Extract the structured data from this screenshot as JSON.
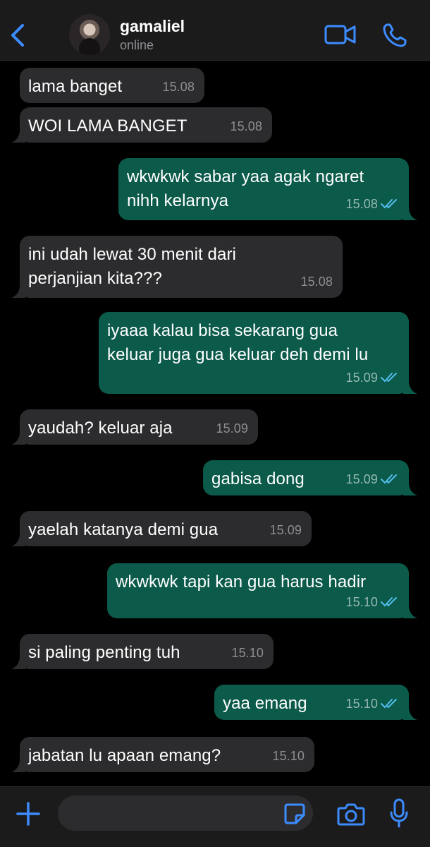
{
  "header": {
    "back_icon": "chevron-left-icon",
    "contact_name": "gamaliel",
    "contact_status": "online",
    "video_icon": "video-call-icon",
    "call_icon": "phone-icon",
    "accent_color": "#3d8cff"
  },
  "messages": [
    {
      "direction": "in",
      "text": [
        "lama banget"
      ],
      "time": "15.08"
    },
    {
      "direction": "in",
      "text": [
        "WOI LAMA BANGET"
      ],
      "time": "15.08"
    },
    {
      "direction": "out",
      "text": [
        "wkwkwk sabar yaa agak ngaret",
        "nihh kelarnya"
      ],
      "time": "15.08",
      "read": true
    },
    {
      "direction": "in",
      "text": [
        "ini udah lewat 30 menit dari",
        "perjanjian kita???"
      ],
      "time": "15.08"
    },
    {
      "direction": "out",
      "text": [
        "iyaaa kalau bisa sekarang gua",
        "keluar juga gua keluar deh demi lu"
      ],
      "time": "15.09",
      "read": true
    },
    {
      "direction": "in",
      "text": [
        "yaudah? keluar aja"
      ],
      "time": "15.09"
    },
    {
      "direction": "out",
      "text": [
        "gabisa dong"
      ],
      "time": "15.09",
      "read": true
    },
    {
      "direction": "in",
      "text": [
        "yaelah katanya demi gua"
      ],
      "time": "15.09"
    },
    {
      "direction": "out",
      "text": [
        "wkwkwk tapi kan gua harus hadir"
      ],
      "time": "15.10",
      "read": true
    },
    {
      "direction": "in",
      "text": [
        "si paling penting tuh"
      ],
      "time": "15.10"
    },
    {
      "direction": "out",
      "text": [
        "yaa emang"
      ],
      "time": "15.10",
      "read": true
    },
    {
      "direction": "in",
      "text": [
        "jabatan lu apaan emang?"
      ],
      "time": "15.10"
    }
  ],
  "footer": {
    "input_value": "",
    "plus_icon": "plus-icon",
    "sticker_icon": "sticker-icon",
    "camera_icon": "camera-icon",
    "mic_icon": "microphone-icon"
  },
  "colors": {
    "incoming_bubble": "#2c2c2e",
    "outgoing_bubble": "#0b5a4a",
    "read_tick": "#53bdeb"
  }
}
